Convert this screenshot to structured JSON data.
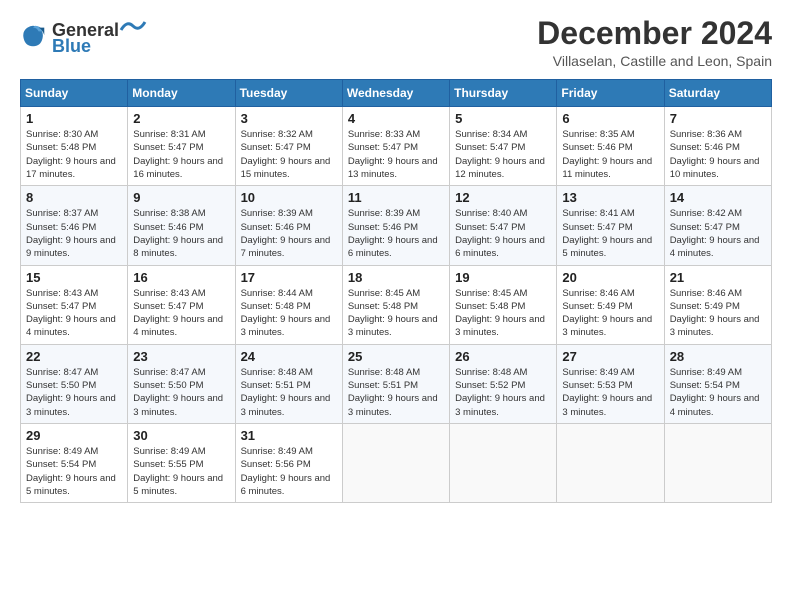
{
  "header": {
    "logo_general": "General",
    "logo_blue": "Blue",
    "title": "December 2024",
    "location": "Villaselan, Castille and Leon, Spain"
  },
  "weekdays": [
    "Sunday",
    "Monday",
    "Tuesday",
    "Wednesday",
    "Thursday",
    "Friday",
    "Saturday"
  ],
  "weeks": [
    [
      {
        "day": "1",
        "sunrise": "8:30 AM",
        "sunset": "5:48 PM",
        "daylight": "9 hours and 17 minutes."
      },
      {
        "day": "2",
        "sunrise": "8:31 AM",
        "sunset": "5:47 PM",
        "daylight": "9 hours and 16 minutes."
      },
      {
        "day": "3",
        "sunrise": "8:32 AM",
        "sunset": "5:47 PM",
        "daylight": "9 hours and 15 minutes."
      },
      {
        "day": "4",
        "sunrise": "8:33 AM",
        "sunset": "5:47 PM",
        "daylight": "9 hours and 13 minutes."
      },
      {
        "day": "5",
        "sunrise": "8:34 AM",
        "sunset": "5:47 PM",
        "daylight": "9 hours and 12 minutes."
      },
      {
        "day": "6",
        "sunrise": "8:35 AM",
        "sunset": "5:46 PM",
        "daylight": "9 hours and 11 minutes."
      },
      {
        "day": "7",
        "sunrise": "8:36 AM",
        "sunset": "5:46 PM",
        "daylight": "9 hours and 10 minutes."
      }
    ],
    [
      {
        "day": "8",
        "sunrise": "8:37 AM",
        "sunset": "5:46 PM",
        "daylight": "9 hours and 9 minutes."
      },
      {
        "day": "9",
        "sunrise": "8:38 AM",
        "sunset": "5:46 PM",
        "daylight": "9 hours and 8 minutes."
      },
      {
        "day": "10",
        "sunrise": "8:39 AM",
        "sunset": "5:46 PM",
        "daylight": "9 hours and 7 minutes."
      },
      {
        "day": "11",
        "sunrise": "8:39 AM",
        "sunset": "5:46 PM",
        "daylight": "9 hours and 6 minutes."
      },
      {
        "day": "12",
        "sunrise": "8:40 AM",
        "sunset": "5:47 PM",
        "daylight": "9 hours and 6 minutes."
      },
      {
        "day": "13",
        "sunrise": "8:41 AM",
        "sunset": "5:47 PM",
        "daylight": "9 hours and 5 minutes."
      },
      {
        "day": "14",
        "sunrise": "8:42 AM",
        "sunset": "5:47 PM",
        "daylight": "9 hours and 4 minutes."
      }
    ],
    [
      {
        "day": "15",
        "sunrise": "8:43 AM",
        "sunset": "5:47 PM",
        "daylight": "9 hours and 4 minutes."
      },
      {
        "day": "16",
        "sunrise": "8:43 AM",
        "sunset": "5:47 PM",
        "daylight": "9 hours and 4 minutes."
      },
      {
        "day": "17",
        "sunrise": "8:44 AM",
        "sunset": "5:48 PM",
        "daylight": "9 hours and 3 minutes."
      },
      {
        "day": "18",
        "sunrise": "8:45 AM",
        "sunset": "5:48 PM",
        "daylight": "9 hours and 3 minutes."
      },
      {
        "day": "19",
        "sunrise": "8:45 AM",
        "sunset": "5:48 PM",
        "daylight": "9 hours and 3 minutes."
      },
      {
        "day": "20",
        "sunrise": "8:46 AM",
        "sunset": "5:49 PM",
        "daylight": "9 hours and 3 minutes."
      },
      {
        "day": "21",
        "sunrise": "8:46 AM",
        "sunset": "5:49 PM",
        "daylight": "9 hours and 3 minutes."
      }
    ],
    [
      {
        "day": "22",
        "sunrise": "8:47 AM",
        "sunset": "5:50 PM",
        "daylight": "9 hours and 3 minutes."
      },
      {
        "day": "23",
        "sunrise": "8:47 AM",
        "sunset": "5:50 PM",
        "daylight": "9 hours and 3 minutes."
      },
      {
        "day": "24",
        "sunrise": "8:48 AM",
        "sunset": "5:51 PM",
        "daylight": "9 hours and 3 minutes."
      },
      {
        "day": "25",
        "sunrise": "8:48 AM",
        "sunset": "5:51 PM",
        "daylight": "9 hours and 3 minutes."
      },
      {
        "day": "26",
        "sunrise": "8:48 AM",
        "sunset": "5:52 PM",
        "daylight": "9 hours and 3 minutes."
      },
      {
        "day": "27",
        "sunrise": "8:49 AM",
        "sunset": "5:53 PM",
        "daylight": "9 hours and 3 minutes."
      },
      {
        "day": "28",
        "sunrise": "8:49 AM",
        "sunset": "5:54 PM",
        "daylight": "9 hours and 4 minutes."
      }
    ],
    [
      {
        "day": "29",
        "sunrise": "8:49 AM",
        "sunset": "5:54 PM",
        "daylight": "9 hours and 5 minutes."
      },
      {
        "day": "30",
        "sunrise": "8:49 AM",
        "sunset": "5:55 PM",
        "daylight": "9 hours and 5 minutes."
      },
      {
        "day": "31",
        "sunrise": "8:49 AM",
        "sunset": "5:56 PM",
        "daylight": "9 hours and 6 minutes."
      },
      null,
      null,
      null,
      null
    ]
  ],
  "labels": {
    "sunrise": "Sunrise:",
    "sunset": "Sunset:",
    "daylight": "Daylight:"
  }
}
